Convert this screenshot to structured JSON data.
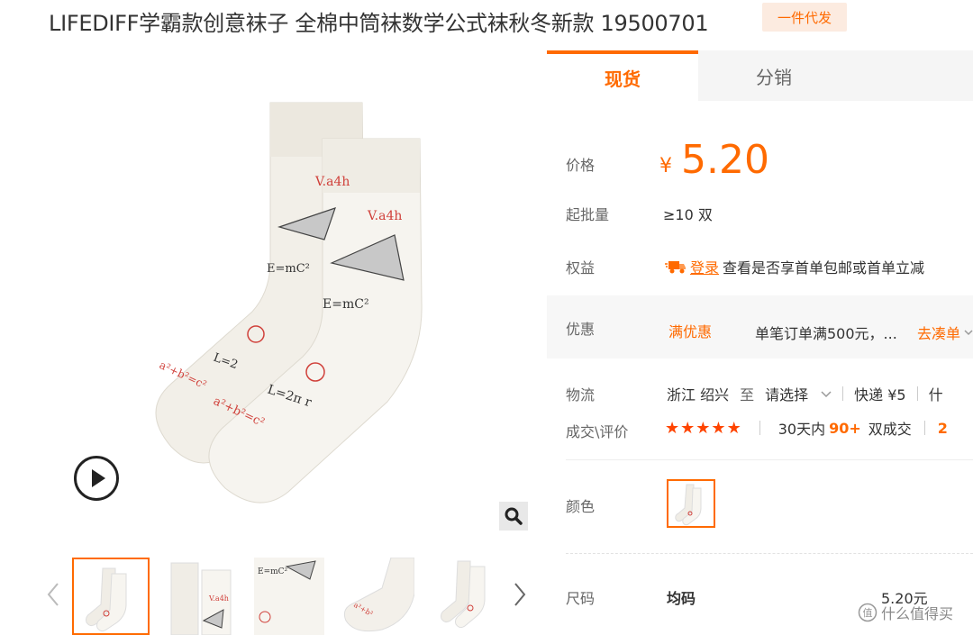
{
  "header": {
    "title": "LIFEDIFF学霸款创意袜子 全棉中筒袜数学公式袜秋冬新款 19500701",
    "badge": "一件代发"
  },
  "gallery": {
    "sock_texts": [
      "V.a4h",
      "E=mC²",
      "L=2",
      "a²+b²=c²",
      "V.a4h",
      "E=mC²",
      "L=2π r",
      "a²+b²=c²"
    ],
    "thumbnails_count": 5,
    "active_thumbnail": 0
  },
  "tabs": [
    {
      "label": "现货",
      "active": true
    },
    {
      "label": "分销",
      "active": false
    }
  ],
  "price": {
    "label": "价格",
    "currency": "¥",
    "value": "5.20"
  },
  "moq": {
    "label": "起批量",
    "value": "≥10 双"
  },
  "benefits": {
    "label": "权益",
    "link": "登录",
    "text": "查看是否享首单包邮或首单立减"
  },
  "promo": {
    "label": "优惠",
    "tag": "满优惠",
    "text": "单笔订单满500元，...",
    "action": "去凑单"
  },
  "logistics": {
    "label": "物流",
    "from": "浙江 绍兴",
    "to_word": "至",
    "select": "请选择",
    "shipping": "快递 ¥5",
    "more": "什"
  },
  "transactions": {
    "label": "成交\\评价",
    "stars": 5,
    "prefix": "30天内",
    "count": "90+",
    "suffix": "双成交",
    "more": "2"
  },
  "color": {
    "label": "颜色"
  },
  "size": {
    "label": "尺码",
    "value": "均码",
    "price": "5.20元"
  },
  "watermark": {
    "text": "什么值得买"
  }
}
